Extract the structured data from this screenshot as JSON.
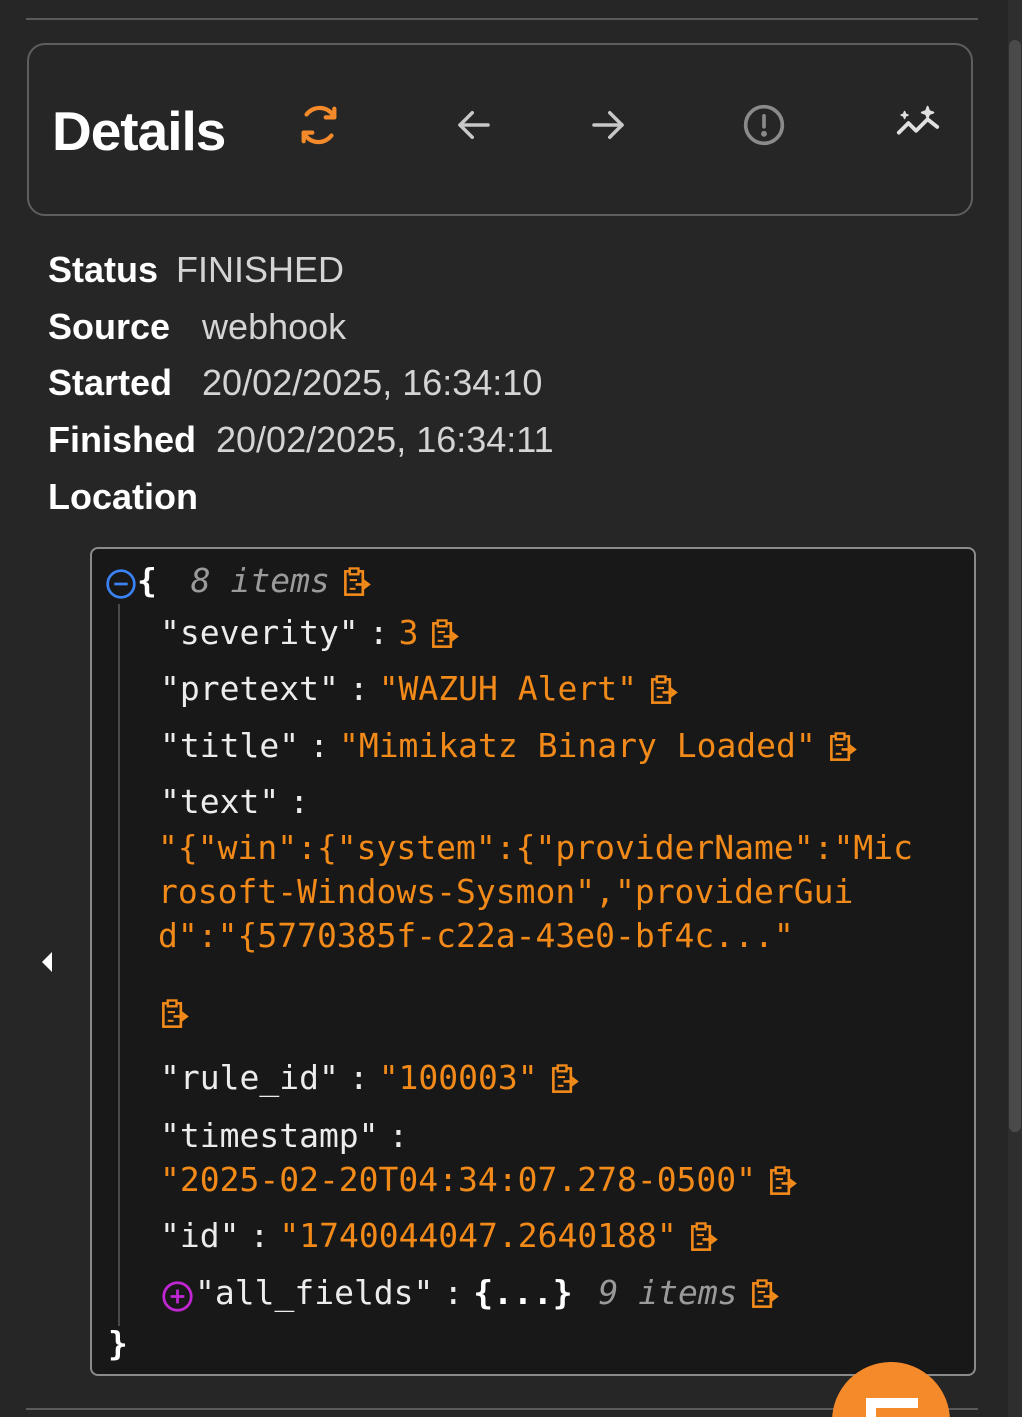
{
  "header": {
    "title": "Details",
    "buttons": [
      {
        "name": "refresh-icon",
        "color": "#f58a2b"
      },
      {
        "name": "arrow-left-icon",
        "color": "#c8c8c8"
      },
      {
        "name": "arrow-right-icon",
        "color": "#c8c8c8"
      },
      {
        "name": "alert-circle-icon",
        "color": "#8a8a8a"
      },
      {
        "name": "sparkle-chart-icon",
        "color": "#e0e0e0"
      }
    ]
  },
  "meta": {
    "status_label": "Status",
    "status_value": "FINISHED",
    "source_label": "Source",
    "source_value": "webhook",
    "started_label": "Started",
    "started_value": "20/02/2025, 16:34:10",
    "finished_label": "Finished",
    "finished_value": "20/02/2025, 16:34:11",
    "location_label": "Location"
  },
  "json_view": {
    "root_open": "{",
    "root_close": "}",
    "root_count": "8 items",
    "fields": {
      "severity": {
        "key": "\"severity\"",
        "value": "3"
      },
      "pretext": {
        "key": "\"pretext\"",
        "value": "\"WAZUH Alert\""
      },
      "title": {
        "key": "\"title\"",
        "value": "\"Mimikatz Binary Loaded\""
      },
      "text": {
        "key": "\"text\"",
        "value": "\"{\"win\":{\"system\":{\"providerName\":\"Microsoft-Windows-Sysmon\",\"providerGuid\":\"{5770385f-c22a-43e0-bf4c...\""
      },
      "rule_id": {
        "key": "\"rule_id\"",
        "value": "\"100003\""
      },
      "timestamp": {
        "key": "\"timestamp\"",
        "value": "\"2025-02-20T04:34:07.278-0500\""
      },
      "id": {
        "key": "\"id\"",
        "value": "\"1740044047.2640188\""
      },
      "all_fields": {
        "key": "\"all_fields\"",
        "value": "{...}",
        "count": "9 items"
      }
    },
    "colon": ":",
    "colors": {
      "string": "#f28a1a",
      "collapse": "#3b82f6",
      "expand": "#c026d3"
    }
  },
  "fab": {
    "icon": "menu-icon",
    "color": "#f58a2b"
  }
}
